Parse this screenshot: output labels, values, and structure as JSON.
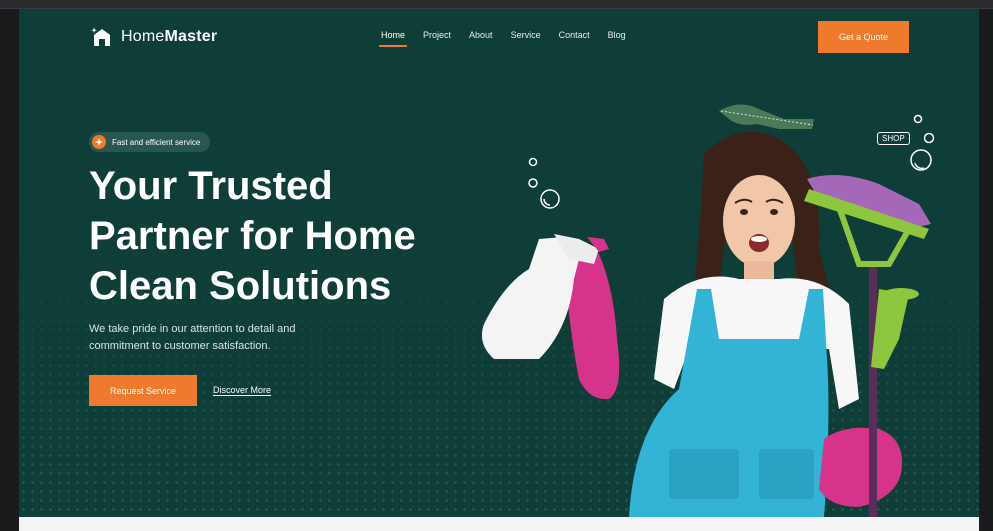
{
  "brand": {
    "name_light": "Home",
    "name_bold": "Master"
  },
  "nav": {
    "items": [
      {
        "label": "Home",
        "active": true
      },
      {
        "label": "Project",
        "active": false
      },
      {
        "label": "About",
        "active": false
      },
      {
        "label": "Service",
        "active": false
      },
      {
        "label": "Contact",
        "active": false
      },
      {
        "label": "Blog",
        "active": false
      }
    ]
  },
  "header": {
    "cta_label": "Get a Quote"
  },
  "hero": {
    "badge": "Fast and efficient service",
    "headline_line1": "Your Trusted",
    "headline_line2": "Partner for Home",
    "headline_line3": "Clean Solutions",
    "subtext_line1": "We take pride in our attention to detail and",
    "subtext_line2": "commitment to customer satisfaction.",
    "primary_cta": "Request Service",
    "secondary_cta": "Discover More",
    "shop_sign": "SHOP"
  },
  "colors": {
    "background": "#0f3d38",
    "accent": "#f07a2c",
    "text": "#ffffff",
    "apron": "#33b3d6",
    "gloves": "#d6338a",
    "mop": "#8fc63f"
  },
  "icons": [
    "logo-icon",
    "sparkle-icon"
  ]
}
